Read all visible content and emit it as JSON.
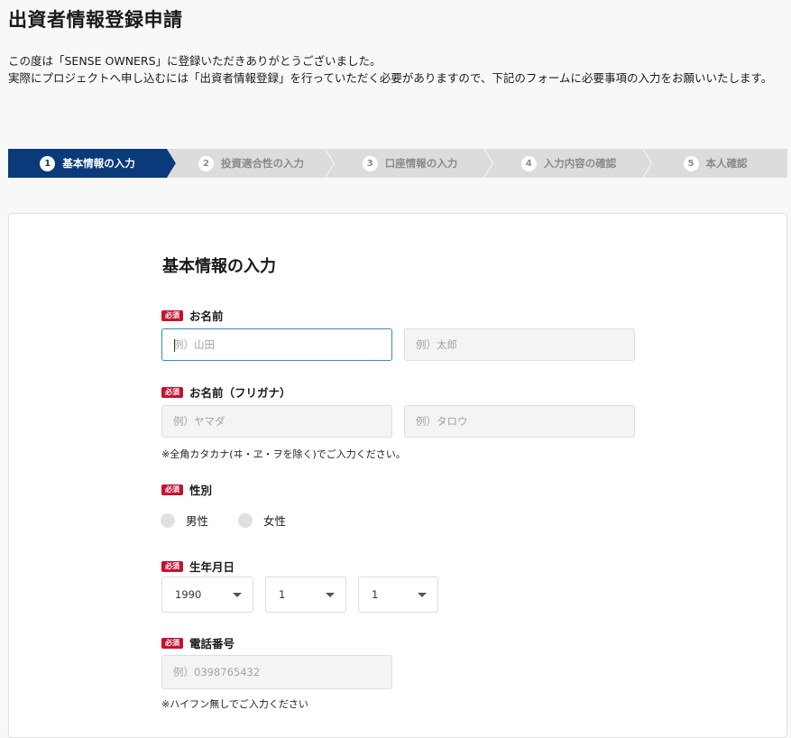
{
  "page": {
    "title": "出資者情報登録申請",
    "intro_line1": "この度は「SENSE OWNERS」に登録いただきありがとうございました。",
    "intro_line2": "実際にプロジェクトへ申し込むには「出資者情報登録」を行っていただく必要がありますので、下記のフォームに必要事項の入力をお願いいたします。"
  },
  "steps": [
    {
      "num": "1",
      "label": "基本情報の入力",
      "active": true
    },
    {
      "num": "2",
      "label": "投資適合性の入力",
      "active": false
    },
    {
      "num": "3",
      "label": "口座情報の入力",
      "active": false
    },
    {
      "num": "4",
      "label": "入力内容の確認",
      "active": false
    },
    {
      "num": "5",
      "label": "本人確認",
      "active": false
    }
  ],
  "colors": {
    "step_active": "#0b3a7a",
    "step_inactive": "#dcdcdc",
    "required_badge": "#c4122f",
    "focus_border": "#2f8fbf"
  },
  "form": {
    "title": "基本情報の入力",
    "required_badge": "必須",
    "name": {
      "label": "お名前",
      "last_placeholder": "例）山田",
      "first_placeholder": "例）太郎",
      "last_value": "",
      "first_value": ""
    },
    "kana": {
      "label": "お名前（フリガナ）",
      "last_placeholder": "例）ヤマダ",
      "first_placeholder": "例）タロウ",
      "note": "※全角カタカナ(ヰ・ヱ・ヲを除く)でご入力ください。"
    },
    "gender": {
      "label": "性別",
      "options": [
        "男性",
        "女性"
      ]
    },
    "birthdate": {
      "label": "生年月日",
      "year": "1990",
      "month": "1",
      "day": "1"
    },
    "phone": {
      "label": "電話番号",
      "placeholder": "例）0398765432",
      "note": "※ハイフン無しでご入力ください"
    }
  }
}
